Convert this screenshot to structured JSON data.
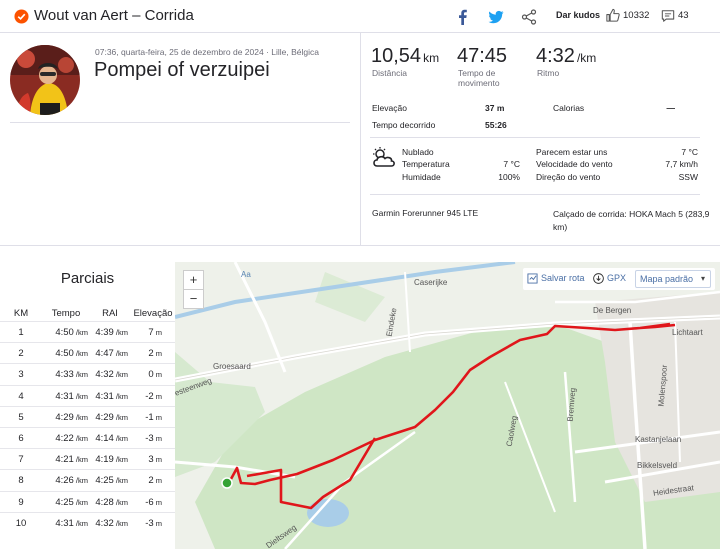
{
  "header": {
    "title": "Wout van Aert – Corrida",
    "kudos_button": "Dar kudos",
    "kudos_count": "10332",
    "comment_count": "43"
  },
  "activity": {
    "date_line": "07:36, quarta-feira, 25 de dezembro de 2024 · Lille, Bélgica",
    "name": "Pompei of verzuipei"
  },
  "stats": {
    "distance": "10,54",
    "distance_unit": "km",
    "distance_label": "Distância",
    "moving_time": "47:45",
    "moving_time_label": "Tempo de movimento",
    "pace": "4:32",
    "pace_unit": "/km",
    "pace_label": "Ritmo",
    "elevation_label": "Elevação",
    "elevation_value": "37 m",
    "calories_label": "Calorias",
    "calories_value": "—",
    "elapsed_label": "Tempo decorrido",
    "elapsed_value": "55:26"
  },
  "weather": {
    "condition": "Nublado",
    "temperature_label": "Temperatura",
    "temperature_value": "7 °C",
    "humidity_label": "Humidade",
    "humidity_value": "100%",
    "feels_like_label": "Parecem estar uns",
    "feels_like_value": "7 °C",
    "wind_speed_label": "Velocidade do vento",
    "wind_speed_value": "7,7 km/h",
    "wind_dir_label": "Direção do vento",
    "wind_dir_value": "SSW"
  },
  "gear": {
    "device": "Garmin Forerunner 945 LTE",
    "shoes": "Calçado de corrida: HOKA Mach 5 (283,9 km)"
  },
  "splits": {
    "title": "Parciais",
    "headers": [
      "KM",
      "Tempo",
      "RAI",
      "Elevação"
    ],
    "pace_unit": "/km",
    "elev_unit": "m",
    "rows": [
      {
        "km": "1",
        "time": "4:50",
        "gap": "4:39",
        "elev": "7"
      },
      {
        "km": "2",
        "time": "4:50",
        "gap": "4:47",
        "elev": "2"
      },
      {
        "km": "3",
        "time": "4:33",
        "gap": "4:32",
        "elev": "0"
      },
      {
        "km": "4",
        "time": "4:31",
        "gap": "4:31",
        "elev": "-2"
      },
      {
        "km": "5",
        "time": "4:29",
        "gap": "4:29",
        "elev": "-1"
      },
      {
        "km": "6",
        "time": "4:22",
        "gap": "4:14",
        "elev": "-3"
      },
      {
        "km": "7",
        "time": "4:21",
        "gap": "4:19",
        "elev": "3"
      },
      {
        "km": "8",
        "time": "4:26",
        "gap": "4:25",
        "elev": "2"
      },
      {
        "km": "9",
        "time": "4:25",
        "gap": "4:28",
        "elev": "-6"
      },
      {
        "km": "10",
        "time": "4:31",
        "gap": "4:32",
        "elev": "-3"
      }
    ]
  },
  "map": {
    "zoom_in": "+",
    "zoom_out": "−",
    "save_route": "Salvar rota",
    "gpx": "GPX",
    "map_style": "Mapa padrão",
    "labels": {
      "caserijke": "Caserijke",
      "de_bergen": "De Bergen",
      "lichtaart": "Lichtaart",
      "groesaard": "Groesaard",
      "esteenweg": "esteenweg",
      "eindeke": "Eindeke",
      "kastanjelaan": "Kastanjelaan",
      "bikkelsveld": "Bikkelsveld",
      "heidestraat": "Heidestraat",
      "bremweg": "Bremweg",
      "caolweg": "Caolweg",
      "dieltsweg": "Dieltsweg",
      "molenspoor": "Molenspoor",
      "aa": "Aa"
    }
  },
  "colors": {
    "brand": "#fc5200",
    "route": "#e0161b",
    "start": "#35a335"
  }
}
